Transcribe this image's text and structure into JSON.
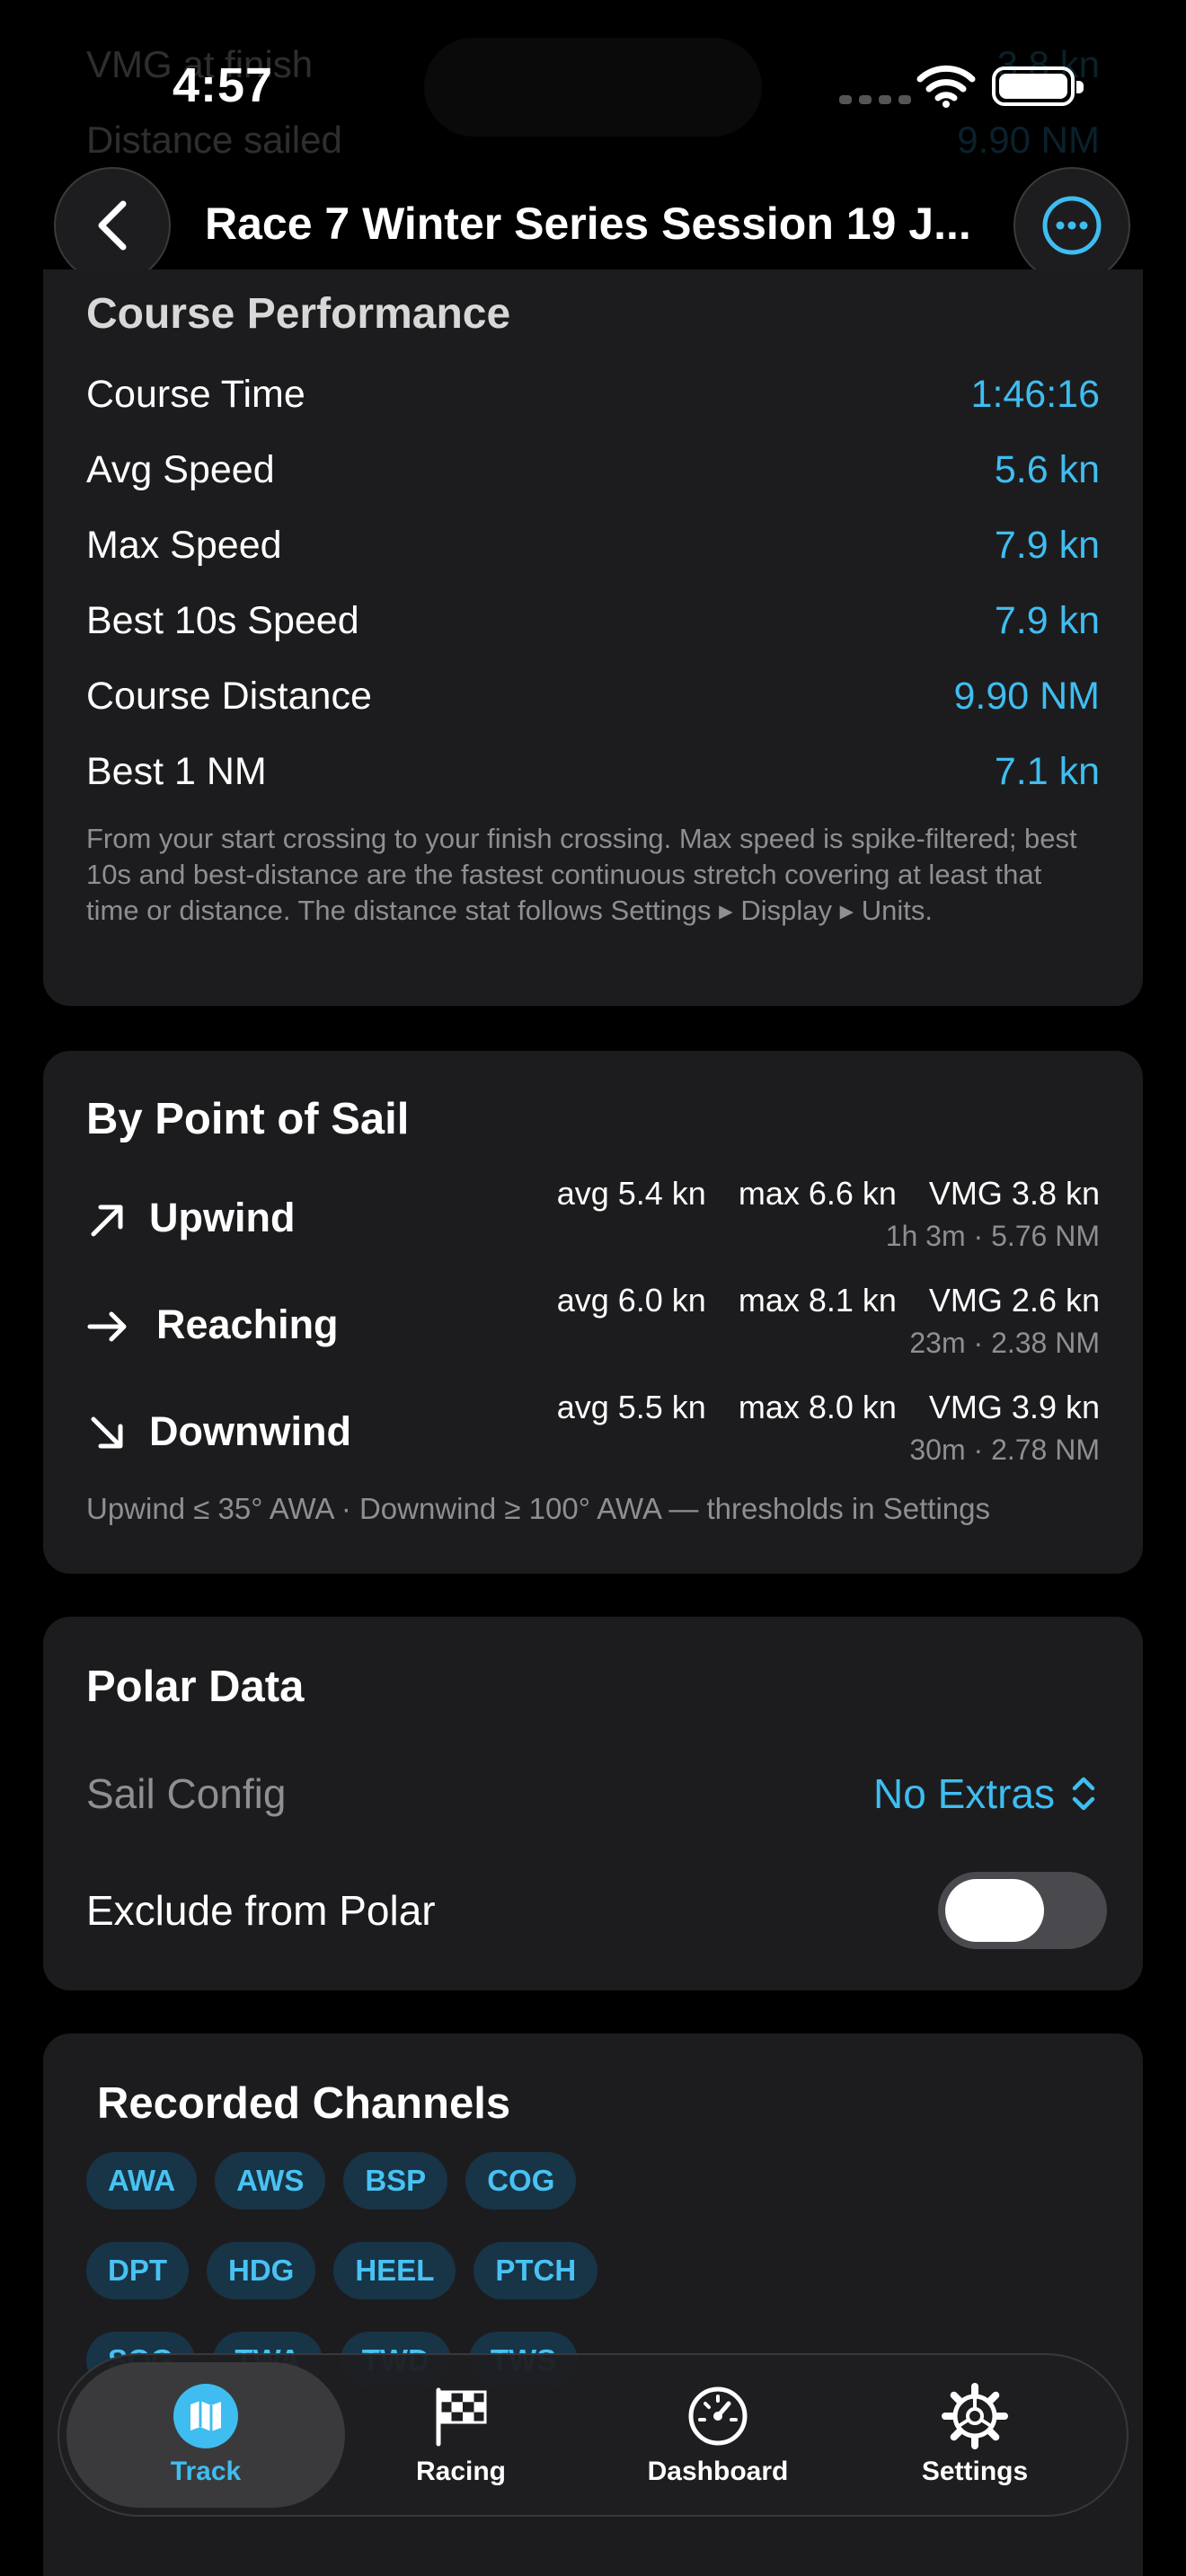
{
  "ghost_rows": [
    {
      "label": "VMG at finish",
      "value": "3.8 kn"
    },
    {
      "label": "Distance sailed",
      "value": "9.90 NM"
    }
  ],
  "status": {
    "time": "4:57"
  },
  "nav": {
    "title": "Race 7 Winter Series Session 19 J..."
  },
  "course_performance": {
    "header": "Course Performance",
    "rows": [
      {
        "label": "Course Time",
        "value": "1:46:16"
      },
      {
        "label": "Avg Speed",
        "value": "5.6 kn"
      },
      {
        "label": "Max Speed",
        "value": "7.9 kn"
      },
      {
        "label": "Best 10s Speed",
        "value": "7.9 kn"
      },
      {
        "label": "Course Distance",
        "value": "9.90 NM"
      },
      {
        "label": "Best 1 NM",
        "value": "7.1 kn"
      }
    ],
    "footnote": "From your start crossing to your finish crossing. Max speed is spike-filtered; best 10s and best-distance are the fastest continuous stretch covering at least that time or distance. The distance stat follows Settings ▸ Display ▸ Units."
  },
  "point_of_sail": {
    "title": "By Point of Sail",
    "rows": [
      {
        "name": "Upwind",
        "icon": "arrow-up-right-icon",
        "avg": "avg 5.4 kn",
        "max": "max 6.6 kn",
        "vmg": "VMG 3.8 kn",
        "sub": "1h 3m · 5.76 NM"
      },
      {
        "name": "Reaching",
        "icon": "arrow-right-icon",
        "avg": "avg 6.0 kn",
        "max": "max 8.1 kn",
        "vmg": "VMG 2.6 kn",
        "sub": "23m · 2.38 NM"
      },
      {
        "name": "Downwind",
        "icon": "arrow-down-right-icon",
        "avg": "avg 5.5 kn",
        "max": "max 8.0 kn",
        "vmg": "VMG 3.9 kn",
        "sub": "30m · 2.78 NM"
      }
    ],
    "footnote": "Upwind ≤ 35° AWA · Downwind ≥ 100° AWA — thresholds in Settings"
  },
  "polar": {
    "title": "Polar Data",
    "sail_config_label": "Sail Config",
    "sail_config_value": "No Extras",
    "exclude_label": "Exclude from Polar",
    "exclude_on": false
  },
  "channels": {
    "title": "Recorded Channels",
    "items": [
      "AWA",
      "AWS",
      "BSP",
      "COG",
      "DPT",
      "HDG",
      "HEEL",
      "PTCH",
      "SOG",
      "TWA",
      "TWD",
      "TWS"
    ]
  },
  "tabs": [
    {
      "label": "Track",
      "icon": "map-icon",
      "active": true
    },
    {
      "label": "Racing",
      "icon": "checkered-flag-icon",
      "active": false
    },
    {
      "label": "Dashboard",
      "icon": "gauge-icon",
      "active": false
    },
    {
      "label": "Settings",
      "icon": "gear-icon",
      "active": false
    }
  ],
  "colors": {
    "accent": "#3fbdf0",
    "card": "#1c1c1e",
    "background": "#000000",
    "muted": "#8e8e93"
  }
}
